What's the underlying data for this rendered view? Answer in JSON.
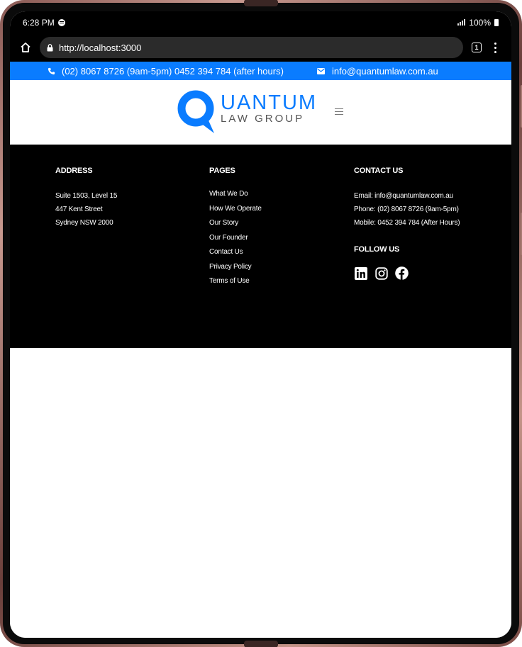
{
  "status_bar": {
    "time": "6:28 PM",
    "battery": "100%"
  },
  "browser": {
    "url": "http://localhost:3000",
    "tab_count": "1"
  },
  "top_bar": {
    "phone_text": "(02) 8067 8726 (9am-5pm) 0452 394 784 (after hours)",
    "email": "info@quantumlaw.com.au"
  },
  "header": {
    "logo_main": "UANTUM",
    "logo_sub": "LAW GROUP"
  },
  "footer": {
    "address": {
      "heading": "ADDRESS",
      "lines": [
        "Suite 1503, Level 15",
        "447 Kent Street",
        "Sydney NSW 2000"
      ]
    },
    "pages": {
      "heading": "PAGES",
      "links": [
        "What We Do",
        "How We Operate",
        "Our Story",
        "Our Founder",
        "Contact Us",
        "Privacy Policy",
        "Terms of Use"
      ]
    },
    "contact": {
      "heading": "CONTACT US",
      "email_line": "Email: info@quantumlaw.com.au",
      "phone_line": "Phone: (02) 8067 8726 (9am-5pm)",
      "mobile_line": "Mobile: 0452 394 784 (After Hours)"
    },
    "follow": {
      "heading": "FOLLOW US",
      "icons": [
        "linkedin-icon",
        "instagram-icon",
        "facebook-icon"
      ]
    }
  },
  "colors": {
    "brand_blue": "#0a7cff",
    "footer_bg": "#000000"
  }
}
